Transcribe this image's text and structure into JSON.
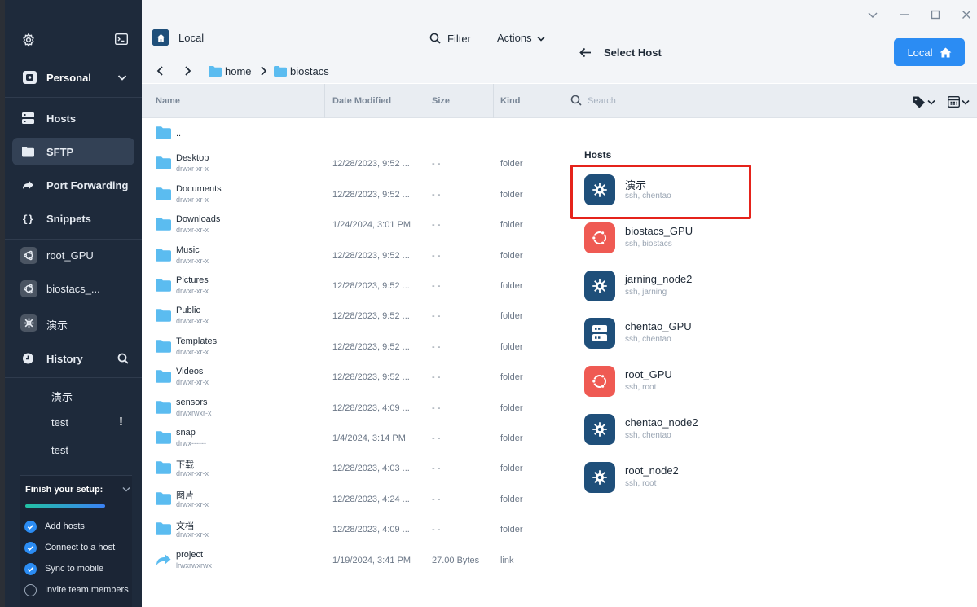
{
  "colors": {
    "sidebar_bg": "#1e2a3b",
    "accent_blue": "#2b8cf3",
    "host_icon_navy": "#1f4f7a",
    "host_icon_red": "#ef5a53",
    "highlight_red": "#e5231b"
  },
  "sidebar": {
    "vault_label": "Personal",
    "nav": [
      {
        "label": "Hosts",
        "icon": "hosts-icon"
      },
      {
        "label": "SFTP",
        "icon": "folder-icon",
        "active": true
      },
      {
        "label": "Port Forwarding",
        "icon": "port-forwarding-icon"
      },
      {
        "label": "Snippets",
        "icon": "snippets-icon"
      }
    ],
    "hosts": [
      {
        "label": "root_GPU",
        "icon": "ubuntu-icon"
      },
      {
        "label": "biostacs_...",
        "icon": "ubuntu-icon"
      },
      {
        "label": "演示",
        "icon": "gear-host-icon"
      }
    ],
    "history_label": "History",
    "history": [
      "演示",
      "test",
      "test"
    ],
    "history_alert": "!",
    "setup": {
      "title": "Finish your setup:",
      "items": [
        {
          "label": "Add hosts",
          "done": true
        },
        {
          "label": "Connect to a host",
          "done": true
        },
        {
          "label": "Sync to mobile",
          "done": true
        },
        {
          "label": "Invite team members",
          "done": false
        }
      ]
    }
  },
  "local_pane": {
    "title": "Local",
    "filter_label": "Filter",
    "actions_label": "Actions",
    "breadcrumb": [
      "home",
      "biostacs"
    ],
    "columns": [
      "Name",
      "Date Modified",
      "Size",
      "Kind"
    ],
    "files": [
      {
        "name": "..",
        "perm": "",
        "date": "",
        "size": "",
        "kind": "",
        "type": "parent"
      },
      {
        "name": "Desktop",
        "perm": "drwxr-xr-x",
        "date": "12/28/2023, 9:52 ...",
        "size": "- -",
        "kind": "folder",
        "type": "folder"
      },
      {
        "name": "Documents",
        "perm": "drwxr-xr-x",
        "date": "12/28/2023, 9:52 ...",
        "size": "- -",
        "kind": "folder",
        "type": "folder"
      },
      {
        "name": "Downloads",
        "perm": "drwxr-xr-x",
        "date": "1/24/2024, 3:01 PM",
        "size": "- -",
        "kind": "folder",
        "type": "folder"
      },
      {
        "name": "Music",
        "perm": "drwxr-xr-x",
        "date": "12/28/2023, 9:52 ...",
        "size": "- -",
        "kind": "folder",
        "type": "folder"
      },
      {
        "name": "Pictures",
        "perm": "drwxr-xr-x",
        "date": "12/28/2023, 9:52 ...",
        "size": "- -",
        "kind": "folder",
        "type": "folder"
      },
      {
        "name": "Public",
        "perm": "drwxr-xr-x",
        "date": "12/28/2023, 9:52 ...",
        "size": "- -",
        "kind": "folder",
        "type": "folder"
      },
      {
        "name": "Templates",
        "perm": "drwxr-xr-x",
        "date": "12/28/2023, 9:52 ...",
        "size": "- -",
        "kind": "folder",
        "type": "folder"
      },
      {
        "name": "Videos",
        "perm": "drwxr-xr-x",
        "date": "12/28/2023, 9:52 ...",
        "size": "- -",
        "kind": "folder",
        "type": "folder"
      },
      {
        "name": "sensors",
        "perm": "drwxrwxr-x",
        "date": "12/28/2023, 4:09 ...",
        "size": "- -",
        "kind": "folder",
        "type": "folder"
      },
      {
        "name": "snap",
        "perm": "drwx------",
        "date": "1/4/2024, 3:14 PM",
        "size": "- -",
        "kind": "folder",
        "type": "folder"
      },
      {
        "name": "下载",
        "perm": "drwxr-xr-x",
        "date": "12/28/2023, 4:03 ...",
        "size": "- -",
        "kind": "folder",
        "type": "folder"
      },
      {
        "name": "图片",
        "perm": "drwxr-xr-x",
        "date": "12/28/2023, 4:24 ...",
        "size": "- -",
        "kind": "folder",
        "type": "folder"
      },
      {
        "name": "文档",
        "perm": "drwxr-xr-x",
        "date": "12/28/2023, 4:09 ...",
        "size": "- -",
        "kind": "folder",
        "type": "folder"
      },
      {
        "name": "project",
        "perm": "lrwxrwxrwx",
        "date": "1/19/2024, 3:41 PM",
        "size": "27.00 Bytes",
        "kind": "link",
        "type": "link"
      }
    ]
  },
  "host_pane": {
    "title": "Select Host",
    "local_button": "Local",
    "search_placeholder": "Search",
    "section_label": "Hosts",
    "hosts": [
      {
        "name": "演示",
        "sub": "ssh, chentao",
        "icon": "gear-host-icon",
        "color": "#1f4f7a",
        "highlighted": true
      },
      {
        "name": "biostacs_GPU",
        "sub": "ssh, biostacs",
        "icon": "ubuntu-icon",
        "color": "#ef5a53"
      },
      {
        "name": "jarning_node2",
        "sub": "ssh, jarning",
        "icon": "gear-host-icon",
        "color": "#1f4f7a"
      },
      {
        "name": "chentao_GPU",
        "sub": "ssh, chentao",
        "icon": "server-icon",
        "color": "#1f4f7a"
      },
      {
        "name": "root_GPU",
        "sub": "ssh, root",
        "icon": "ubuntu-icon",
        "color": "#ef5a53"
      },
      {
        "name": "chentao_node2",
        "sub": "ssh, chentao",
        "icon": "gear-host-icon",
        "color": "#1f4f7a"
      },
      {
        "name": "root_node2",
        "sub": "ssh, root",
        "icon": "gear-host-icon",
        "color": "#1f4f7a"
      }
    ]
  }
}
